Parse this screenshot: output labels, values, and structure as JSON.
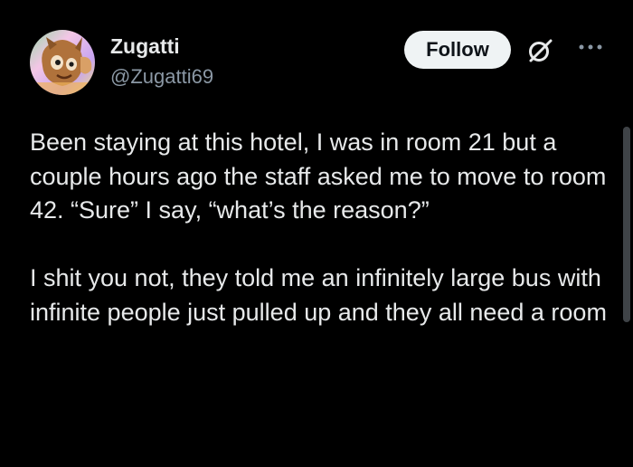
{
  "post": {
    "author": {
      "display_name": "Zugatti",
      "handle": "@Zugatti69",
      "avatar_icon": "avatar-cartoon-fox-icon"
    },
    "actions": {
      "follow_label": "Follow",
      "grok_icon": "slashed-circle-icon",
      "more_icon": "more-dots-icon"
    },
    "paragraphs": [
      "Been staying at this hotel, I was in room 21 but a couple hours ago the staff asked me to move to room 42. “Sure” I say, “what’s the reason?”",
      "I shit you not, they told me an infinitely large bus with infinite people just pulled up and they all need a room"
    ]
  },
  "colors": {
    "background": "#000000",
    "primary_text": "#e7e9ea",
    "secondary_text": "#8b98a5",
    "follow_button_bg": "#eff3f4",
    "follow_button_text": "#0f1419"
  }
}
